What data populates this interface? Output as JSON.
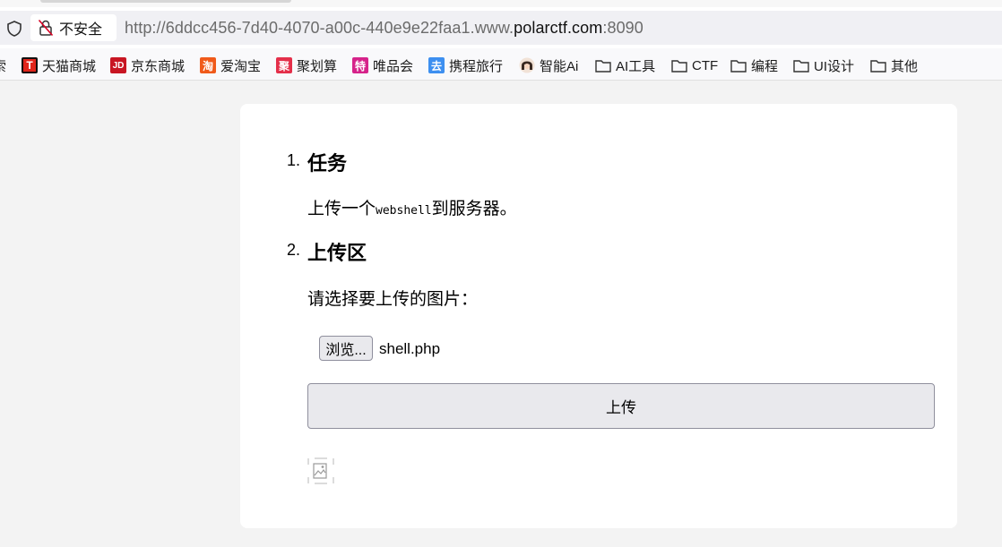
{
  "browser": {
    "security_label": "不安全",
    "url_prefix": "http://6ddcc456-7d40-4070-a00c-440e9e22faa1.www.",
    "url_domain": "polarctf.com",
    "url_suffix": ":8090"
  },
  "bookmarks": [
    {
      "label": "索",
      "icon": "cut-off-icon"
    },
    {
      "label": "天猫商城",
      "icon": "tmall-icon",
      "icon_text": "T",
      "color": "#e1251b"
    },
    {
      "label": "京东商城",
      "icon": "jd-icon",
      "icon_text": "JD",
      "color": "#c81623"
    },
    {
      "label": "爱淘宝",
      "icon": "taobao-icon",
      "icon_text": "淘",
      "color": "#f05a1a"
    },
    {
      "label": "聚划算",
      "icon": "juhuasuan-icon",
      "icon_text": "聚",
      "color": "#e42f4a"
    },
    {
      "label": "唯品会",
      "icon": "vip-icon",
      "icon_text": "特",
      "color": "#d6238a"
    },
    {
      "label": "携程旅行",
      "icon": "ctrip-icon",
      "icon_text": "去",
      "color": "#3d8ff0"
    },
    {
      "label": "智能Ai",
      "icon": "avatar-icon"
    },
    {
      "label": "AI工具",
      "icon": "folder-icon"
    },
    {
      "label": "CTF",
      "icon": "folder-icon"
    },
    {
      "label": "编程",
      "icon": "folder-icon"
    },
    {
      "label": "UI设计",
      "icon": "folder-icon"
    },
    {
      "label": "其他",
      "icon": "folder-icon"
    }
  ],
  "page": {
    "item1_number": "1.",
    "item1_heading": "任务",
    "item1_text_before": "上传一个",
    "item1_code": "webshell",
    "item1_text_after": "到服务器。",
    "item2_number": "2.",
    "item2_heading": "上传区",
    "prompt": "请选择要上传的图片：",
    "browse_label": "浏览...",
    "filename": "shell.php",
    "upload_label": "上传"
  },
  "colors": {
    "page_bg": "#f3f3f3",
    "card_bg": "#ffffff",
    "button_bg": "#e9e9ed"
  }
}
